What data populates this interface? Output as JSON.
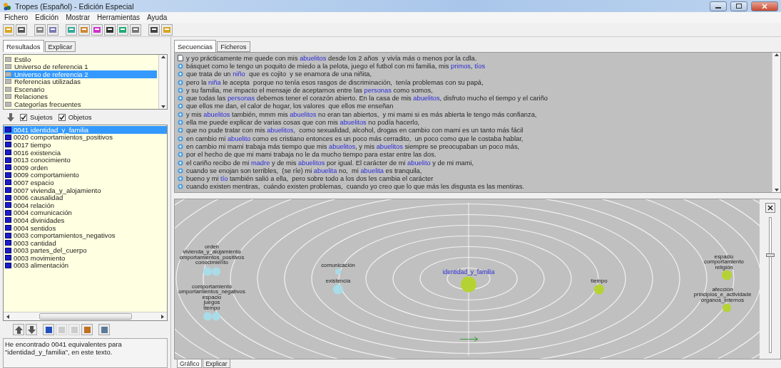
{
  "window": {
    "title": "Tropes (Español) - Edición Especial"
  },
  "menu": [
    "Fichero",
    "Edición",
    "Mostrar",
    "Herramientas",
    "Ayuda"
  ],
  "left_panel": {
    "tabs": [
      {
        "label": "Resultados",
        "selected": true
      },
      {
        "label": "Explicar",
        "selected": false
      }
    ],
    "categories": [
      {
        "label": "Estilo",
        "selected": false
      },
      {
        "label": "Universo de referencia 1",
        "selected": false
      },
      {
        "label": "Universo de referencia 2",
        "selected": true
      },
      {
        "label": "Referencias utilizadas",
        "selected": false
      },
      {
        "label": "Escenario",
        "selected": false
      },
      {
        "label": "Relaciones",
        "selected": false
      },
      {
        "label": "Categorías frecuentes",
        "selected": false
      }
    ],
    "filters": [
      {
        "label": "Sujetos",
        "checked": true
      },
      {
        "label": "Objetos",
        "checked": true
      }
    ],
    "results": [
      {
        "label": "0041 identidad_y_familia",
        "selected": true
      },
      {
        "label": "0020 comportamientos_positivos",
        "selected": false
      },
      {
        "label": "0017 tiempo",
        "selected": false
      },
      {
        "label": "0016 existencia",
        "selected": false
      },
      {
        "label": "0013 conocimiento",
        "selected": false
      },
      {
        "label": "0009 orden",
        "selected": false
      },
      {
        "label": "0009 comportamiento",
        "selected": false
      },
      {
        "label": "0007 espacio",
        "selected": false
      },
      {
        "label": "0007 vivienda_y_alojamiento",
        "selected": false
      },
      {
        "label": "0006 causalidad",
        "selected": false
      },
      {
        "label": "0004 relación",
        "selected": false
      },
      {
        "label": "0004 comunicación",
        "selected": false
      },
      {
        "label": "0004 divinidades",
        "selected": false
      },
      {
        "label": "0004 sentidos",
        "selected": false
      },
      {
        "label": "0003 comportamientos_negativos",
        "selected": false
      },
      {
        "label": "0003 cantidad",
        "selected": false
      },
      {
        "label": "0003 partes_del_cuerpo",
        "selected": false
      },
      {
        "label": "0003 movimiento",
        "selected": false
      },
      {
        "label": "0003 alimentación",
        "selected": false
      }
    ],
    "message": "He encontrado 0041 equivalentes para \"identidad_y_familia\", en este texto."
  },
  "sequences": {
    "tabs": [
      {
        "label": "Secuencias",
        "selected": true
      },
      {
        "label": "Ficheros",
        "selected": false
      }
    ],
    "lines": [
      {
        "kind": "document",
        "segments": [
          {
            "text": "y yo prácticamente me quede con mis ",
            "highlight": false
          },
          {
            "text": "abuelitos",
            "highlight": true
          },
          {
            "text": " desde los 2 años  y vivía más o menos por la cdla.",
            "highlight": false
          }
        ]
      },
      {
        "kind": "bullet",
        "segments": [
          {
            "text": "básquet como le tengo un poquito de miedo a la pelota, juego el futbol con mi familia, mis ",
            "highlight": false
          },
          {
            "text": "primos",
            "highlight": true
          },
          {
            "text": ", ",
            "highlight": false
          },
          {
            "text": "tíos",
            "highlight": true
          }
        ]
      },
      {
        "kind": "bullet",
        "segments": [
          {
            "text": "que trata de un ",
            "highlight": false
          },
          {
            "text": "niño",
            "highlight": true
          },
          {
            "text": "  que es cojito  y se enamora de una niñita,",
            "highlight": false
          }
        ]
      },
      {
        "kind": "bullet",
        "segments": [
          {
            "text": "pero la ",
            "highlight": false
          },
          {
            "text": "niña",
            "highlight": true
          },
          {
            "text": " le acepta  porque no tenía esos rasgos de discriminación,  tenía problemas con su papá,",
            "highlight": false
          }
        ]
      },
      {
        "kind": "bullet",
        "segments": [
          {
            "text": "y su familia, me impacto el mensaje de aceptarnos entre las ",
            "highlight": false
          },
          {
            "text": "personas",
            "highlight": true
          },
          {
            "text": " como somos,",
            "highlight": false
          }
        ]
      },
      {
        "kind": "bullet",
        "segments": [
          {
            "text": "que todas las ",
            "highlight": false
          },
          {
            "text": "personas",
            "highlight": true
          },
          {
            "text": " debemos tener el corazón abierto. En la casa de mis ",
            "highlight": false
          },
          {
            "text": "abuelitos",
            "highlight": true
          },
          {
            "text": ", disfruto mucho el tiempo y el cariño",
            "highlight": false
          }
        ]
      },
      {
        "kind": "bullet",
        "segments": [
          {
            "text": "que ellos me dan, el calor de hogar, los valores  que ellos me enseñan",
            "highlight": false
          }
        ]
      },
      {
        "kind": "bullet",
        "segments": [
          {
            "text": "y mis ",
            "highlight": false
          },
          {
            "text": "abuelitos",
            "highlight": true
          },
          {
            "text": " también, mmm mis ",
            "highlight": false
          },
          {
            "text": "abuelitos",
            "highlight": true
          },
          {
            "text": " no eran tan abiertos,  y mi mami si es más abierta le tengo más confianza,",
            "highlight": false
          }
        ]
      },
      {
        "kind": "bullet",
        "segments": [
          {
            "text": "ella me puede explicar de varias cosas que con mis ",
            "highlight": false
          },
          {
            "text": "abuelitos",
            "highlight": true
          },
          {
            "text": " no podía hacerlo,",
            "highlight": false
          }
        ]
      },
      {
        "kind": "bullet",
        "segments": [
          {
            "text": "que no pude tratar con mis ",
            "highlight": false
          },
          {
            "text": "abuelitos",
            "highlight": true
          },
          {
            "text": ",  como sexualidad, alcohol, drogas en cambio con mami es un tanto más fácil",
            "highlight": false
          }
        ]
      },
      {
        "kind": "bullet",
        "segments": [
          {
            "text": "en cambio mi ",
            "highlight": false
          },
          {
            "text": "abuelito",
            "highlight": true
          },
          {
            "text": " como es cristiano entonces es un poco más cerradito,  un poco como que le costaba hablar,",
            "highlight": false
          }
        ]
      },
      {
        "kind": "bullet",
        "segments": [
          {
            "text": "en cambio mi mami trabaja más tiempo que mis ",
            "highlight": false
          },
          {
            "text": "abuelitos",
            "highlight": true
          },
          {
            "text": ", y mis ",
            "highlight": false
          },
          {
            "text": "abuelitos",
            "highlight": true
          },
          {
            "text": " siempre se preocupaban un poco más,",
            "highlight": false
          }
        ]
      },
      {
        "kind": "bullet",
        "segments": [
          {
            "text": "por el hecho de que mi mami trabaja no le da mucho tiempo para estar entre las dos.",
            "highlight": false
          }
        ]
      },
      {
        "kind": "bullet",
        "segments": [
          {
            "text": "el cariño recibo de mi ",
            "highlight": false
          },
          {
            "text": "madre",
            "highlight": true
          },
          {
            "text": " y de mis ",
            "highlight": false
          },
          {
            "text": "abuelitos",
            "highlight": true
          },
          {
            "text": " por igual. El carácter de mi ",
            "highlight": false
          },
          {
            "text": "abuelito",
            "highlight": true
          },
          {
            "text": " y de mi mami,",
            "highlight": false
          }
        ]
      },
      {
        "kind": "bullet",
        "segments": [
          {
            "text": "cuando se enojan son terribles,  (se ríe) mi ",
            "highlight": false
          },
          {
            "text": "abuelita",
            "highlight": true
          },
          {
            "text": " no,  mi ",
            "highlight": false
          },
          {
            "text": "abuelita",
            "highlight": true
          },
          {
            "text": " es tranquila,",
            "highlight": false
          }
        ]
      },
      {
        "kind": "bullet",
        "segments": [
          {
            "text": "bueno y mi ",
            "highlight": false
          },
          {
            "text": "tío",
            "highlight": true
          },
          {
            "text": " también salió a ella,  pero sobre todo a los dos les cambia el carácter",
            "highlight": false
          }
        ]
      },
      {
        "kind": "bullet",
        "segments": [
          {
            "text": "cuando existen mentiras,  cuándo existen problemas,  cuando yo creo que lo que más les disgusta es las mentiras.",
            "highlight": false
          }
        ]
      }
    ]
  },
  "graph": {
    "nodes": [
      {
        "kind": "cluster",
        "color": "#a8dce8",
        "labels": [
          "orden",
          "vivienda_y_alojamiento",
          "omportamientos_positivos",
          "conocimiento"
        ]
      },
      {
        "kind": "cluster",
        "color": "#a8dce8",
        "labels": [
          "comportamiento",
          "omportamientos_negativos",
          "espacio",
          "juegos",
          "tiempo"
        ]
      },
      {
        "kind": "single",
        "color": "#a8dce8",
        "labels": [
          "comunicación"
        ]
      },
      {
        "kind": "single",
        "color": "#a8dce8",
        "labels": [
          "existencia"
        ]
      },
      {
        "kind": "main",
        "color": "#b5d233",
        "labels": [
          "identidad_y_familia"
        ]
      },
      {
        "kind": "single",
        "color": "#b5d233",
        "labels": [
          "tiempo"
        ]
      },
      {
        "kind": "cluster",
        "color": "#b5d233",
        "labels": [
          "espacio",
          "comportamiento",
          "religión"
        ]
      },
      {
        "kind": "cluster",
        "color": "#b5d233",
        "labels": [
          "afección",
          "principios_e_actividade",
          "órganos_internos"
        ]
      }
    ],
    "zoom_slider": {
      "level": 0.72
    },
    "tabs": [
      {
        "label": "Gráfico",
        "selected": true
      },
      {
        "label": "Explicar",
        "selected": false
      }
    ]
  }
}
